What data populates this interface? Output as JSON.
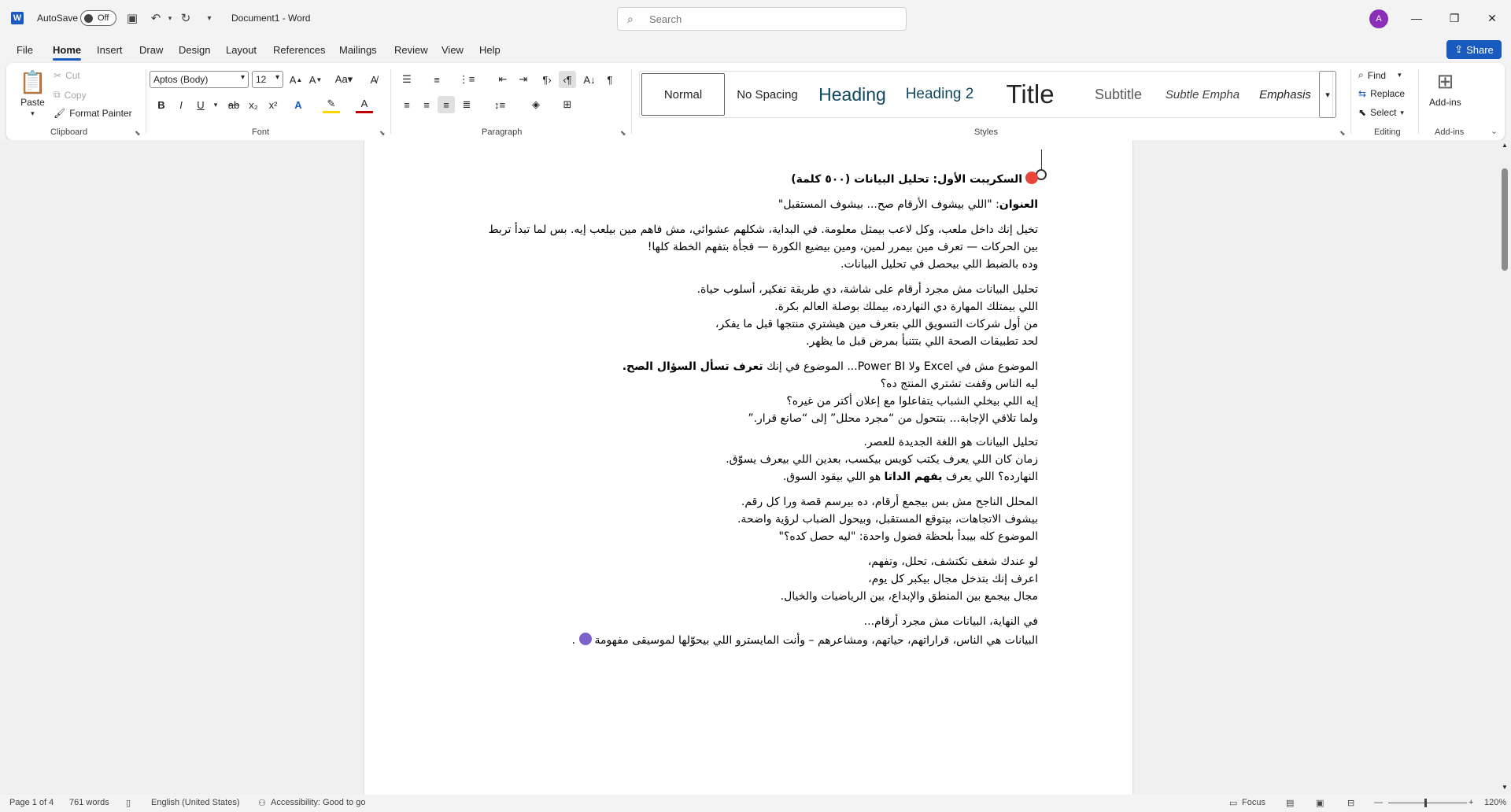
{
  "titlebar": {
    "autosave_label": "AutoSave",
    "autosave_state": "Off",
    "doc_title": "Document1  -  Word",
    "search_placeholder": "Search",
    "avatar_initial": "A"
  },
  "menu": {
    "tabs": [
      "File",
      "Home",
      "Insert",
      "Draw",
      "Design",
      "Layout",
      "References",
      "Mailings",
      "Review",
      "View",
      "Help"
    ],
    "active": "Home",
    "share_label": "Share"
  },
  "ribbon": {
    "clipboard": {
      "label": "Clipboard",
      "paste": "Paste",
      "cut": "Cut",
      "copy": "Copy",
      "format_painter": "Format Painter"
    },
    "font": {
      "label": "Font",
      "family": "Aptos (Body)",
      "size": "12"
    },
    "paragraph": {
      "label": "Paragraph"
    },
    "styles": {
      "label": "Styles",
      "items": [
        "Normal",
        "No Spacing",
        "Heading",
        "Heading 2",
        "Title",
        "Subtitle",
        "Subtle Empha",
        "Emphasis"
      ]
    },
    "editing": {
      "label": "Editing",
      "find": "Find",
      "replace": "Replace",
      "select": "Select"
    },
    "addins": {
      "label": "Add-ins",
      "button": "Add-ins"
    }
  },
  "document": {
    "lines": [
      {
        "text": "السكريبت الأول: تحليل البيانات (٥٠٠ كلمة)",
        "bold": true,
        "emoji": "target"
      },
      {
        "lead_bold": "العنوان",
        "text": ": \"اللي بيشوف الأرقام صح... بيشوف المستقبل\""
      },
      {
        "text": "تخيل إنك داخل ملعب، وكل لاعب بيمثل معلومة. في البداية، شكلهم عشوائي، مش فاهم مين بيلعب إيه. بس لما تبدأ تربط"
      },
      {
        "text": "بين الحركات — تعرف مين بيمرر لمين، ومين بيضيع الكورة — فجأة بتفهم الخطة كلها!"
      },
      {
        "text": "وده بالضبط اللي بيحصل في تحليل البيانات."
      },
      {
        "text": "تحليل البيانات مش مجرد أرقام على شاشة، دي طريقة تفكير، أسلوب حياة."
      },
      {
        "text": "اللي بيمتلك المهارة دي النهارده، بيملك بوصلة العالم بكرة."
      },
      {
        "text": "من أول شركات التسويق اللي بتعرف مين هيشتري منتجها قبل ما يفكر،"
      },
      {
        "text": "لحد تطبيقات الصحة اللي بتتنبأ بمرض قبل ما يظهر."
      },
      {
        "text": "الموضوع مش في Excel ولا Power BI... الموضوع في إنك ",
        "trail_bold": "تعرف تسأل السؤال الصح."
      },
      {
        "text": "ليه الناس وقفت تشتري المنتج ده؟"
      },
      {
        "text": "إيه اللي بيخلي الشباب يتفاعلوا مع إعلان أكتر من غيره؟"
      },
      {
        "text": "ولما تلاقي الإجابة... بتتحول من “مجرد محلل” إلى “صانع قرار.”"
      },
      {
        "text": "تحليل البيانات هو اللغة الجديدة للعصر."
      },
      {
        "text": "زمان كان اللي يعرف يكتب كويس بيكسب، بعدين اللي بيعرف يسوّق."
      },
      {
        "text": "النهارده؟ اللي يعرف ",
        "trail_bold": "يفهم الداتا",
        "after": " هو اللي بيقود السوق."
      },
      {
        "text": "المحلل الناجح مش بس بيجمع أرقام، ده بيرسم قصة ورا كل رقم."
      },
      {
        "text": "بيشوف الاتجاهات، بيتوقع المستقبل، وبيحول الضباب لرؤية واضحة."
      },
      {
        "text": "الموضوع كله بيبدأ بلحظة فضول واحدة: \"ليه حصل كده؟\""
      },
      {
        "text": "لو عندك شغف تكتشف، تحلل، وتفهم،"
      },
      {
        "text": "اعرف إنك بتدخل مجال بيكبر كل يوم،"
      },
      {
        "text": "مجال بيجمع بين المنطق والإبداع، بين الرياضيات والخيال."
      },
      {
        "text": "في النهاية، البيانات مش مجرد أرقام..."
      },
      {
        "text": "البيانات هي الناس، قراراتهم، حياتهم، ومشاعرهم – وأنت المايسترو اللي بيحوّلها لموسيقى مفهومة",
        "emoji": "notes",
        "emoji_end": true
      }
    ]
  },
  "status": {
    "page": "Page 1 of 4",
    "words": "761 words",
    "language": "English (United States)",
    "accessibility": "Accessibility: Good to go",
    "focus": "Focus",
    "zoom": "120%"
  },
  "colors": {
    "accent": "#185abd",
    "avatar": "#8b2fb8"
  }
}
